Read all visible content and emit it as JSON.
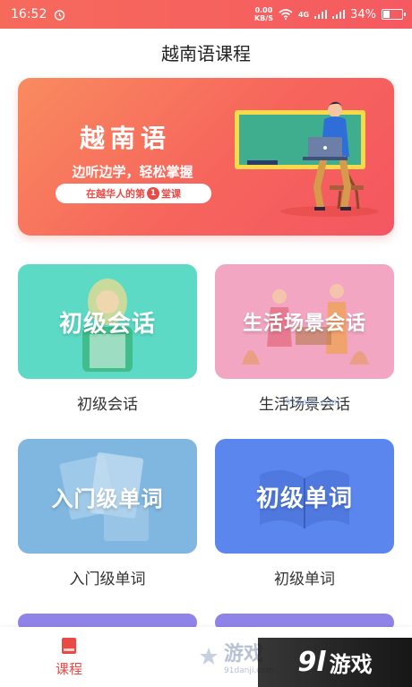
{
  "status": {
    "time": "16:52",
    "net_speed_value": "0.00",
    "net_speed_unit": "KB/S",
    "network": "4G",
    "battery": "34%"
  },
  "header": {
    "title": "越南语课程"
  },
  "banner": {
    "title": "越南语",
    "subtitle": "边听边学，轻松掌握",
    "pill_prefix": "在越华人的第",
    "pill_num": "1",
    "pill_suffix": "堂课"
  },
  "courses": [
    {
      "title": "初级会话",
      "label": "初级会话",
      "color": "#5cdac6"
    },
    {
      "title": "生活场景会话",
      "label": "生活场景会话",
      "color": "#f2a6c1"
    },
    {
      "title": "入门级单词",
      "label": "入门级单词",
      "color": "#7fb7e0"
    },
    {
      "title": "初级单词",
      "label": "初级单词",
      "color": "#5b86ee"
    }
  ],
  "bottom_nav": {
    "course_label": "课程",
    "accent": "#e94a45"
  },
  "watermarks": {
    "mid_text": "91danji.com",
    "nav_big": "游戏",
    "nav_small": "91danji.com",
    "corner_num": "9l",
    "corner_text": "游戏"
  }
}
